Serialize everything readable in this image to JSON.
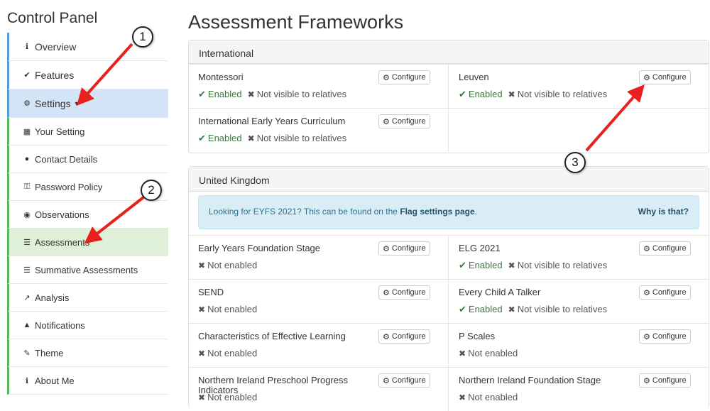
{
  "sidebar": {
    "title": "Control Panel",
    "items": [
      {
        "label": "Overview",
        "icon": "info-icon",
        "glyph": "ℹ"
      },
      {
        "label": "Features",
        "icon": "check-icon",
        "glyph": "✔"
      },
      {
        "label": "Settings",
        "icon": "gear-icon",
        "glyph": "⚙"
      },
      {
        "label": "Your Setting",
        "icon": "building-icon",
        "glyph": "▦"
      },
      {
        "label": "Contact Details",
        "icon": "speech-bubble-icon",
        "glyph": "●"
      },
      {
        "label": "Password Policy",
        "icon": "key-icon",
        "glyph": "⚿"
      },
      {
        "label": "Observations",
        "icon": "eye-icon",
        "glyph": "◉"
      },
      {
        "label": "Assessments",
        "icon": "list-icon",
        "glyph": "☰"
      },
      {
        "label": "Summative Assessments",
        "icon": "list-icon",
        "glyph": "☰"
      },
      {
        "label": "Analysis",
        "icon": "line-chart-icon",
        "glyph": "↗"
      },
      {
        "label": "Notifications",
        "icon": "bell-icon",
        "glyph": "▲"
      },
      {
        "label": "Theme",
        "icon": "brush-icon",
        "glyph": "✎"
      },
      {
        "label": "About Me",
        "icon": "info-icon",
        "glyph": "ℹ"
      }
    ]
  },
  "main": {
    "title": "Assessment Frameworks",
    "configure_label": "Configure",
    "status": {
      "enabled": "Enabled",
      "not_visible": "Not visible to relatives",
      "not_enabled": "Not enabled"
    },
    "international": {
      "heading": "International",
      "frameworks": [
        {
          "name": "Montessori",
          "state": "enabled"
        },
        {
          "name": "Leuven",
          "state": "enabled"
        },
        {
          "name": "International Early Years Curriculum",
          "state": "enabled"
        }
      ]
    },
    "uk": {
      "heading": "United Kingdom",
      "alert": {
        "text": "Looking for EYFS 2021? This can be found on the",
        "link": "Flag settings page",
        "after": ".",
        "why": "Why is that?"
      },
      "frameworks": [
        {
          "name": "Early Years Foundation Stage",
          "state": "not_enabled"
        },
        {
          "name": "ELG 2021",
          "state": "enabled"
        },
        {
          "name": "SEND",
          "state": "not_enabled"
        },
        {
          "name": "Every Child A Talker",
          "state": "enabled"
        },
        {
          "name": "Characteristics of Effective Learning",
          "state": "not_enabled"
        },
        {
          "name": "P Scales",
          "state": "not_enabled"
        },
        {
          "name": "Northern Ireland Preschool Progress Indicators",
          "state": "not_enabled"
        },
        {
          "name": "Northern Ireland Foundation Stage",
          "state": "not_enabled"
        }
      ]
    }
  },
  "annotations": {
    "badge1": "1",
    "badge2": "2",
    "badge3": "3",
    "arrow_color": "#e8201e"
  }
}
